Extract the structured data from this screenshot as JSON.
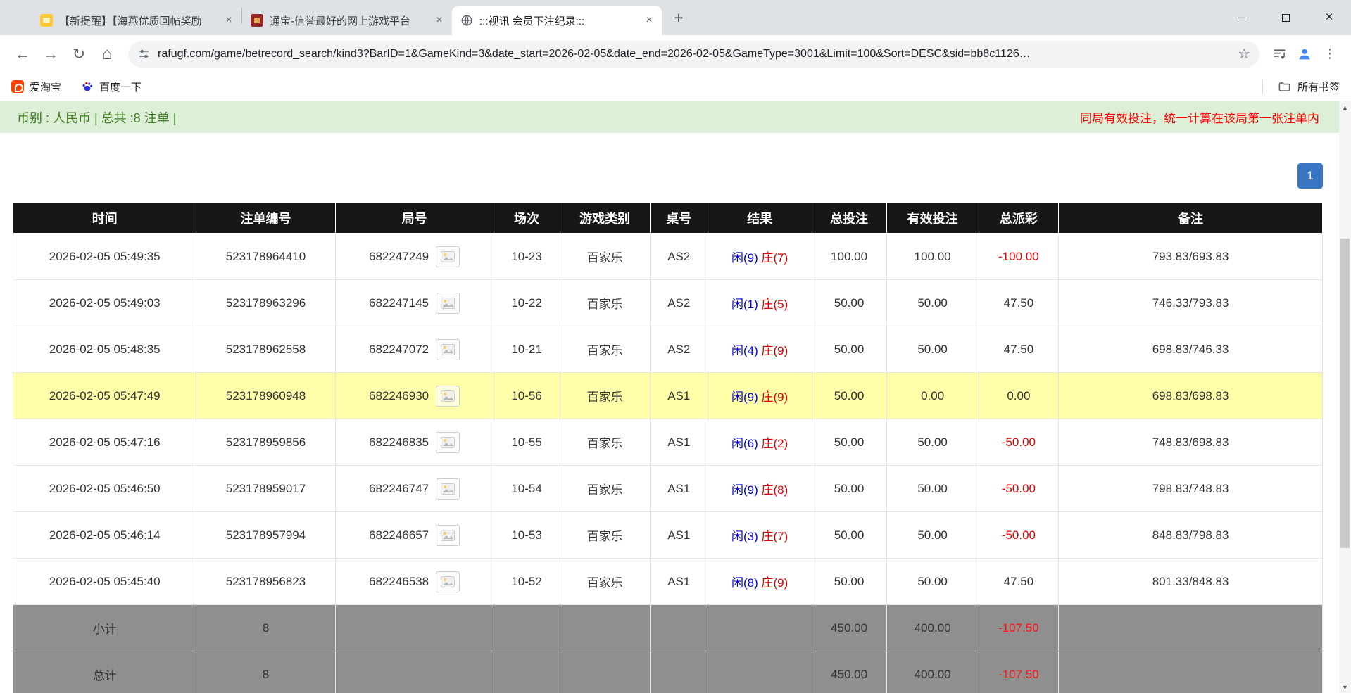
{
  "icons": {
    "back": "←",
    "forward": "→",
    "refresh": "↻",
    "home": "⌂",
    "star": "☆",
    "menu": "⋮",
    "new_tab": "+",
    "tab_close": "×",
    "minimize": "─",
    "close_window": "×",
    "scroll_up": "▲",
    "scroll_down": "▼"
  },
  "browser": {
    "tabs": [
      {
        "title": "【新提醒】【海燕优质回帖奖励"
      },
      {
        "title": "通宝-信誉最好的网上游戏平台"
      },
      {
        "title": ":::视讯 会员下注纪录:::"
      }
    ],
    "omnibox": {
      "url": "rafugf.com/game/betrecord_search/kind3?BarID=1&GameKind=3&date_start=2026-02-05&date_end=2026-02-05&GameType=3001&Limit=100&Sort=DESC&sid=bb8c1126…"
    },
    "bookmarks": {
      "items": [
        {
          "label": "爱淘宝"
        },
        {
          "label": "百度一下"
        }
      ],
      "all_bookmarks": "所有书签"
    }
  },
  "page": {
    "summary": "币别 : 人民币 | 总共 :8 注单 |",
    "notice": "同局有效投注，统一计算在该局第一张注单内",
    "pagination": {
      "current": "1"
    },
    "colors": {
      "accent_blue": "#3a75c4",
      "bet_blue": "#3366cc",
      "player_blue": "#0000dd",
      "banker_red": "#dd0000",
      "negative_red": "#e60000",
      "highlight_yellow": "#ffffaa",
      "summary_green": "#3f7d23"
    },
    "table": {
      "headers": [
        "时间",
        "注单编号",
        "局号",
        "场次",
        "游戏类别",
        "桌号",
        "结果",
        "总投注",
        "有效投注",
        "总派彩",
        "备注"
      ],
      "rows": [
        {
          "time": "2026-02-05 05:49:35",
          "bet_id": "523178964410",
          "round": "682247249",
          "session": "10-23",
          "game": "百家乐",
          "table": "AS2",
          "player": "闲(9)",
          "banker": "庄(7)",
          "total_bet": "100.00",
          "valid_bet": "100.00",
          "payout": "-100.00",
          "note": "793.83/693.83",
          "highlight": false
        },
        {
          "time": "2026-02-05 05:49:03",
          "bet_id": "523178963296",
          "round": "682247145",
          "session": "10-22",
          "game": "百家乐",
          "table": "AS2",
          "player": "闲(1)",
          "banker": "庄(5)",
          "total_bet": "50.00",
          "valid_bet": "50.00",
          "payout": "47.50",
          "note": "746.33/793.83",
          "highlight": false
        },
        {
          "time": "2026-02-05 05:48:35",
          "bet_id": "523178962558",
          "round": "682247072",
          "session": "10-21",
          "game": "百家乐",
          "table": "AS2",
          "player": "闲(4)",
          "banker": "庄(9)",
          "total_bet": "50.00",
          "valid_bet": "50.00",
          "payout": "47.50",
          "note": "698.83/746.33",
          "highlight": false
        },
        {
          "time": "2026-02-05 05:47:49",
          "bet_id": "523178960948",
          "round": "682246930",
          "session": "10-56",
          "game": "百家乐",
          "table": "AS1",
          "player": "闲(9)",
          "banker": "庄(9)",
          "total_bet": "50.00",
          "valid_bet": "0.00",
          "payout": "0.00",
          "note": "698.83/698.83",
          "highlight": true
        },
        {
          "time": "2026-02-05 05:47:16",
          "bet_id": "523178959856",
          "round": "682246835",
          "session": "10-55",
          "game": "百家乐",
          "table": "AS1",
          "player": "闲(6)",
          "banker": "庄(2)",
          "total_bet": "50.00",
          "valid_bet": "50.00",
          "payout": "-50.00",
          "note": "748.83/698.83",
          "highlight": false
        },
        {
          "time": "2026-02-05 05:46:50",
          "bet_id": "523178959017",
          "round": "682246747",
          "session": "10-54",
          "game": "百家乐",
          "table": "AS1",
          "player": "闲(9)",
          "banker": "庄(8)",
          "total_bet": "50.00",
          "valid_bet": "50.00",
          "payout": "-50.00",
          "note": "798.83/748.83",
          "highlight": false
        },
        {
          "time": "2026-02-05 05:46:14",
          "bet_id": "523178957994",
          "round": "682246657",
          "session": "10-53",
          "game": "百家乐",
          "table": "AS1",
          "player": "闲(3)",
          "banker": "庄(7)",
          "total_bet": "50.00",
          "valid_bet": "50.00",
          "payout": "-50.00",
          "note": "848.83/798.83",
          "highlight": false
        },
        {
          "time": "2026-02-05 05:45:40",
          "bet_id": "523178956823",
          "round": "682246538",
          "session": "10-52",
          "game": "百家乐",
          "table": "AS1",
          "player": "闲(8)",
          "banker": "庄(9)",
          "total_bet": "50.00",
          "valid_bet": "50.00",
          "payout": "47.50",
          "note": "801.33/848.83",
          "highlight": false
        }
      ],
      "subtotal": {
        "label": "小计",
        "count": "8",
        "total_bet": "450.00",
        "valid_bet": "400.00",
        "payout": "-107.50"
      },
      "total": {
        "label": "总计",
        "count": "8",
        "total_bet": "450.00",
        "valid_bet": "400.00",
        "payout": "-107.50"
      }
    }
  }
}
